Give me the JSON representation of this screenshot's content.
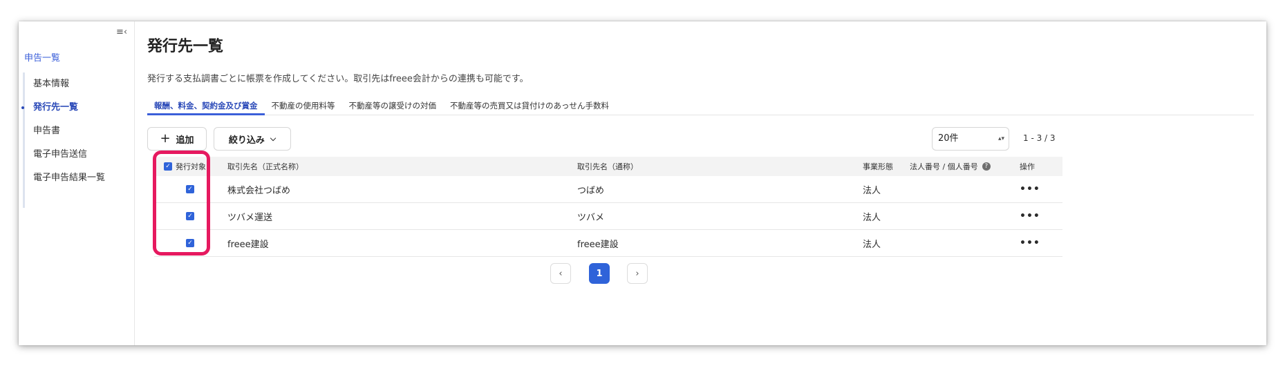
{
  "sidebar": {
    "collapse_glyph": "≡‹",
    "parent": "申告一覧",
    "items": [
      {
        "label": "基本情報"
      },
      {
        "label": "発行先一覧"
      },
      {
        "label": "申告書"
      },
      {
        "label": "電子申告送信"
      },
      {
        "label": "電子申告結果一覧"
      }
    ]
  },
  "main": {
    "title": "発行先一覧",
    "description": "発行する支払調書ごとに帳票を作成してください。取引先はfreee会計からの連携も可能です。",
    "tabs": [
      {
        "label": "報酬、料金、契約金及び賞金"
      },
      {
        "label": "不動産の使用料等"
      },
      {
        "label": "不動産等の譲受けの対価"
      },
      {
        "label": "不動産等の売買又は貸付けのあっせん手数料"
      }
    ],
    "add_label": "追加",
    "filter_label": "絞り込み",
    "per_page": "20件",
    "range": "1 - 3 / 3"
  },
  "table": {
    "headers": {
      "target": "発行対象",
      "name": "取引先名（正式名称）",
      "alias": "取引先名（通称）",
      "type": "事業形態",
      "number": "法人番号 / 個人番号",
      "ops": "操作"
    },
    "rows": [
      {
        "name": "株式会社つばめ",
        "alias": "つばめ",
        "type": "法人",
        "checked": true
      },
      {
        "name": "ツバメ運送",
        "alias": "ツバメ",
        "type": "法人",
        "checked": true
      },
      {
        "name": "freee建設",
        "alias": "freee建設",
        "type": "法人",
        "checked": true
      }
    ]
  },
  "pagination": {
    "current": "1"
  },
  "colors": {
    "accent": "#3b5fd9",
    "highlight": "#e6195f",
    "checkbox": "#2f63d9"
  }
}
